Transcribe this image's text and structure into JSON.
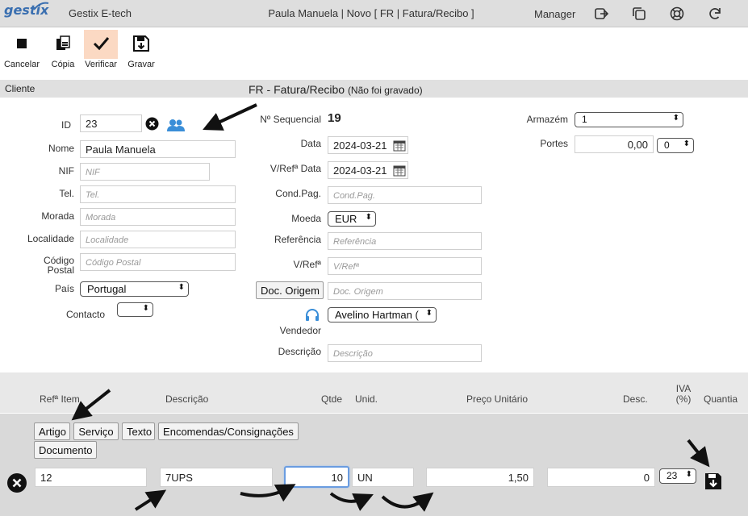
{
  "app": {
    "logo": "gestix",
    "company": "Gestix E-tech",
    "doc_title": "Paula Manuela | Novo [ FR | Fatura/Recibo ]",
    "user": "Manager"
  },
  "toolbar": {
    "cancel": "Cancelar",
    "copy": "Cópia",
    "verify": "Verificar",
    "save": "Gravar"
  },
  "section": {
    "client_label": "Cliente",
    "title": "FR - Fatura/Recibo",
    "status": "(Não foi gravado)"
  },
  "client": {
    "id_label": "ID",
    "id_value": "23",
    "name_label": "Nome",
    "name_value": "Paula Manuela",
    "nif_label": "NIF",
    "nif_placeholder": "NIF",
    "tel_label": "Tel.",
    "tel_placeholder": "Tel.",
    "address_label": "Morada",
    "address_placeholder": "Morada",
    "city_label": "Localidade",
    "city_placeholder": "Localidade",
    "zip_label_1": "Código",
    "zip_label_2": "Postal",
    "zip_placeholder": "Código Postal",
    "country_label": "País",
    "country_value": "Portugal",
    "contact_label": "Contacto",
    "contact_value": ""
  },
  "document": {
    "seq_label": "Nº Sequencial",
    "seq_value": "19",
    "date_label": "Data",
    "date_value": "2024-03-21",
    "ref_date_label": "V/Refª Data",
    "ref_date_value": "2024-03-21",
    "payment_label": "Cond.Pag.",
    "payment_placeholder": "Cond.Pag.",
    "currency_label": "Moeda",
    "currency_value": "EUR",
    "reference_label": "Referência",
    "reference_placeholder": "Referência",
    "vref_label": "V/Refª",
    "vref_placeholder": "V/Refª",
    "origin_button": "Doc. Origem",
    "origin_placeholder": "Doc. Origem",
    "seller_label": "Vendedor",
    "seller_value": "Avelino Hartman (",
    "description_label": "Descrição",
    "description_placeholder": "Descrição"
  },
  "warehouse": {
    "label": "Armazém",
    "value": "1",
    "shipping_label": "Portes",
    "shipping_value": "0,00",
    "shipping_vat": "0"
  },
  "lines": {
    "columns": {
      "ref": "Refª Item",
      "description": "Descrição",
      "qty": "Qtde",
      "unit": "Unid.",
      "price": "Preço Unitário",
      "discount": "Desc.",
      "vat_1": "IVA",
      "vat_2": "(%)",
      "amount": "Quantia"
    },
    "type_buttons": [
      "Artigo",
      "Serviço",
      "Texto",
      "Encomendas/Consignações",
      "Documento"
    ],
    "entry": {
      "ref": "12",
      "description": "7UPS",
      "qty": "10",
      "unit": "UN",
      "price": "1,50",
      "discount": "0",
      "vat": "23"
    }
  }
}
